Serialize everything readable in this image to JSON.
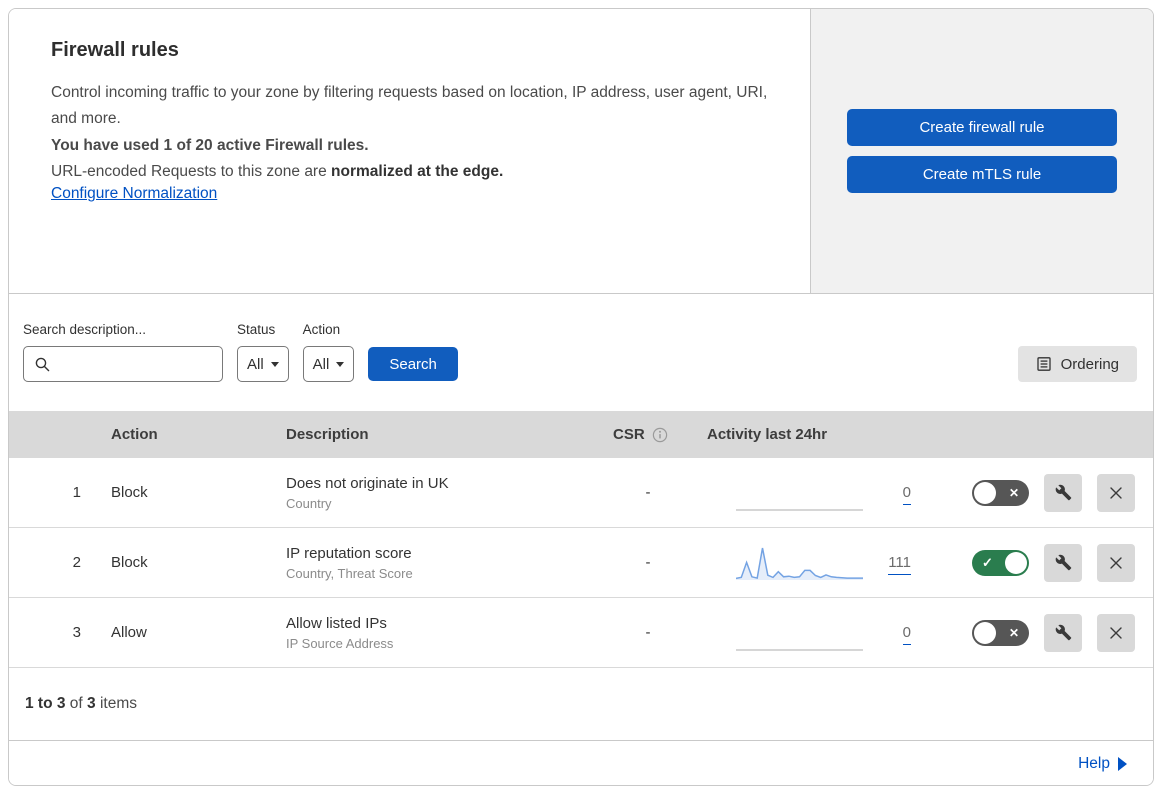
{
  "header": {
    "title": "Firewall rules",
    "description": "Control incoming traffic to your zone by filtering requests based on location, IP address, user agent, URI, and more.",
    "usage": "You have used 1 of 20 active Firewall rules.",
    "normalization_prefix": "URL-encoded Requests to this zone are ",
    "normalization_bold": "normalized at the edge.",
    "configure_link": "Configure Normalization",
    "create_firewall_button": "Create firewall rule",
    "create_mtls_button": "Create mTLS rule"
  },
  "filters": {
    "search_label": "Search description...",
    "search_value": "",
    "status_label": "Status",
    "status_value": "All",
    "action_label": "Action",
    "action_value": "All",
    "search_button": "Search",
    "ordering_button": "Ordering"
  },
  "table": {
    "columns": {
      "action": "Action",
      "description": "Description",
      "csr": "CSR",
      "activity": "Activity last 24hr"
    },
    "rows": [
      {
        "index": "1",
        "action": "Block",
        "description": "Does not originate in UK",
        "criteria": "Country",
        "csr": "-",
        "count": "0",
        "enabled": false,
        "spark_color": "#c9c9c9",
        "spark_fill": "none",
        "spark": [
          0,
          0
        ]
      },
      {
        "index": "2",
        "action": "Block",
        "description": "IP reputation score",
        "criteria": "Country, Threat Score",
        "csr": "-",
        "count": "111",
        "enabled": true,
        "spark_color": "#74a3e3",
        "spark_fill": "rgba(116,163,227,0.18)",
        "spark": [
          5,
          8,
          55,
          10,
          6,
          100,
          15,
          8,
          26,
          10,
          12,
          8,
          10,
          30,
          30,
          14,
          8,
          16,
          10,
          8,
          7,
          6,
          6,
          6,
          6
        ]
      },
      {
        "index": "3",
        "action": "Allow",
        "description": "Allow listed IPs",
        "criteria": "IP Source Address",
        "csr": "-",
        "count": "0",
        "enabled": false,
        "spark_color": "#c9c9c9",
        "spark_fill": "none",
        "spark": [
          0,
          0
        ]
      }
    ]
  },
  "footer": {
    "range": "1 to 3",
    "of_word": "of",
    "total": "3",
    "items_word": "items"
  },
  "help": {
    "label": "Help"
  },
  "colors": {
    "accent_blue": "#115dbe",
    "link_blue": "#0051c3",
    "toggle_on_green": "#2a7d4e",
    "toggle_off_grey": "#565656",
    "panel_grey": "#f1f1f1",
    "table_header_grey": "#d9d9d9"
  }
}
